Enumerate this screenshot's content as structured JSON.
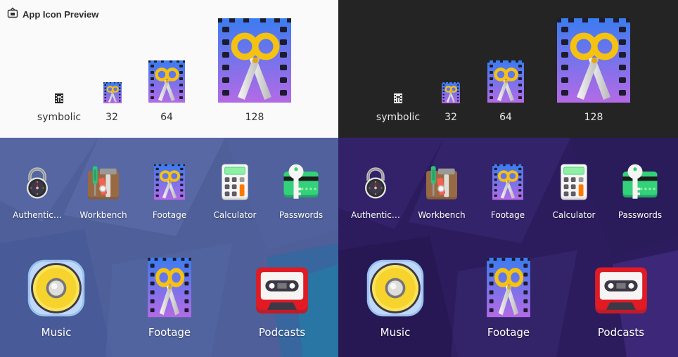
{
  "window": {
    "title": "App Icon Preview"
  },
  "preview": {
    "sizes": [
      "symbolic",
      "32",
      "64",
      "128"
    ]
  },
  "grid": {
    "small_apps": [
      {
        "label": "Authentic…",
        "icon": "authenticator-icon"
      },
      {
        "label": "Workbench",
        "icon": "workbench-icon"
      },
      {
        "label": "Footage",
        "icon": "footage-icon"
      },
      {
        "label": "Calculator",
        "icon": "calculator-icon"
      },
      {
        "label": "Passwords",
        "icon": "passwords-icon"
      }
    ],
    "large_apps": [
      {
        "label": "Music",
        "icon": "music-icon"
      },
      {
        "label": "Footage",
        "icon": "footage-icon"
      },
      {
        "label": "Podcasts",
        "icon": "podcasts-icon"
      }
    ]
  },
  "colors": {
    "light_bg": "#fafafa",
    "dark_bg": "#242424",
    "light_wallpaper": "#4e5f9a",
    "dark_wallpaper": "#2c1c5e",
    "film_gradient_top": "#3b7cf0",
    "film_gradient_bottom": "#b46ae6",
    "scissors_handle": "#f5c211"
  }
}
